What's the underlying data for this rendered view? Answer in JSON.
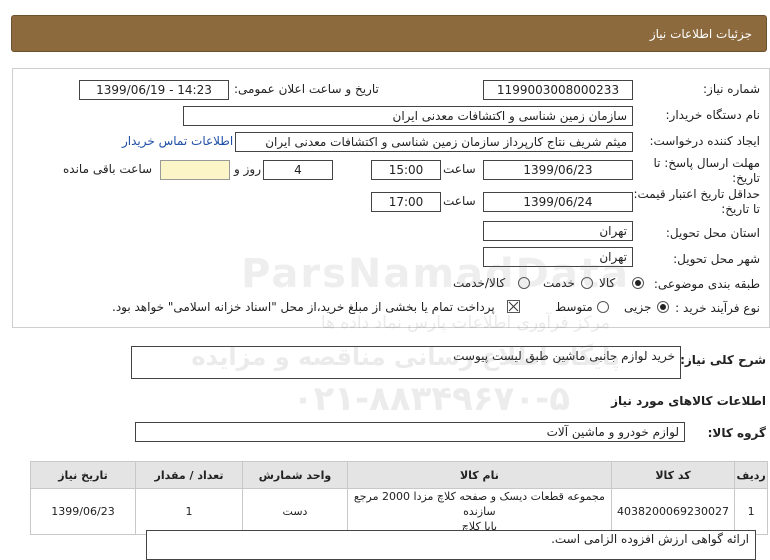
{
  "header": {
    "title": "جزئیات اطلاعات نیاز"
  },
  "form": {
    "need_number_label": "شماره نیاز:",
    "need_number": "1199003008000233",
    "announce_label": "تاریخ و ساعت اعلان عمومی:",
    "announce_value": "1399/06/19 - 14:23",
    "buyer_org_label": "نام دستگاه خریدار:",
    "buyer_org": "سازمان زمین شناسی و اکتشافات معدنی ایران",
    "requester_label": "ایجاد کننده درخواست:",
    "requester": "میثم شریف نتاج کارپرداز سازمان زمین شناسی و اکتشافات معدنی ایران",
    "contact_link": "اطلاعات تماس خریدار",
    "deadline_label_1": "مهلت ارسال پاسخ: تا",
    "deadline_label_2": "تاریخ:",
    "deadline_date": "1399/06/23",
    "time_label": "ساعت",
    "deadline_time": "15:00",
    "days_value": "4",
    "days_label": "روز و",
    "remaining_label": "ساعت باقی مانده",
    "validity_label_1": "حداقل تاریخ اعتبار قیمت:",
    "validity_label_2": "تا تاریخ:",
    "validity_date": "1399/06/24",
    "validity_time": "17:00",
    "province_label": "استان محل تحویل:",
    "province": "تهران",
    "city_label": "شهر محل تحویل:",
    "city": "تهران",
    "category_label": "طبقه بندی موضوعی:",
    "category_options": [
      "کالا",
      "خدمت",
      "کالا/خدمت"
    ],
    "category_selected": "کالا",
    "process_label": "نوع فرآیند خرید :",
    "process_options": [
      "جزیی",
      "متوسط"
    ],
    "process_selected": "جزیی",
    "payment_note": "پرداخت تمام یا بخشی از مبلغ خرید،از محل \"اسناد خزانه اسلامی\" خواهد بود."
  },
  "description": {
    "label": "شرح کلی نیاز:",
    "value": "خرید لوازم جانبی ماشین طبق لیست پیوست"
  },
  "goods_info": {
    "title": "اطلاعات کالاهای مورد نیاز",
    "group_label": "گروه کالا:",
    "group_value": "لوازم خودرو و ماشین آلات"
  },
  "table": {
    "headers": [
      "ردیف",
      "کد کالا",
      "نام کالا",
      "واحد شمارش",
      "تعداد / مقدار",
      "تاریخ نیاز"
    ],
    "rows": [
      {
        "row": "1",
        "code": "4038200069230027",
        "name_line1": "مجموعه قطعات دیسک و صفحه کلاچ مزدا 2000 مرجع سازنده",
        "name_line2": "پایا کلاچ",
        "unit": "دست",
        "qty": "1",
        "date": "1399/06/23"
      }
    ]
  },
  "notes": {
    "line1": "ارائه گواهی ارزش افزوده الزامی است."
  },
  "watermark": {
    "line1": "مرکز فرآوری اطلاعات پارس نماد داده ها",
    "line2": "پایگاه اطلاع رسانی مناقصه و مزایده",
    "phone": "۰۲۱-۸۸۳۴۹۶۷۰-۵",
    "brand": "ParsNamadData"
  },
  "colors": {
    "header_bg": "#8c6a3e",
    "link": "#1f4fa6",
    "remaining_box": "#fbf5c8"
  }
}
